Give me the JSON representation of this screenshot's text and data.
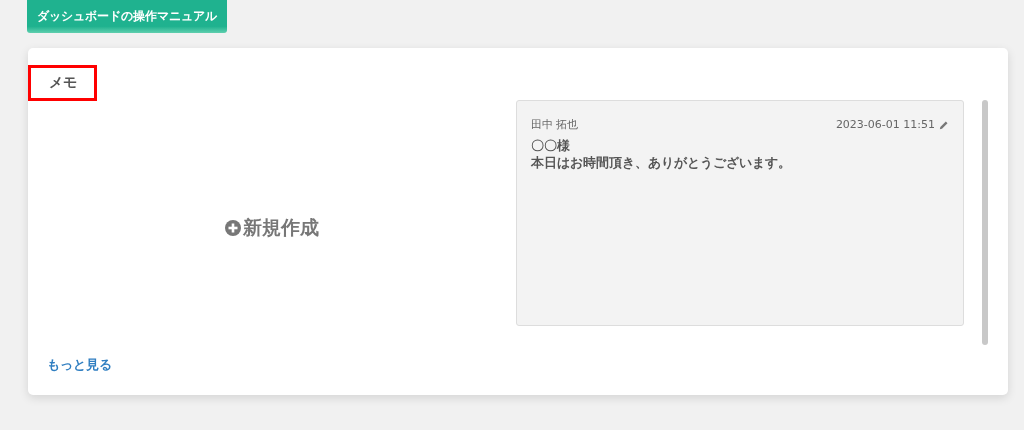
{
  "manual_button": {
    "label": "ダッシュボードの操作マニュアル"
  },
  "memo_panel": {
    "title": {
      "text": "メモ",
      "highlighted": true
    },
    "new_button": {
      "label": "新規作成"
    },
    "memos": [
      {
        "author": "田中 拓也",
        "timestamp": "2023-06-01 11:51",
        "body": [
          "〇〇様",
          "本日はお時間頂き、ありがとうございます。"
        ]
      }
    ],
    "more_link": "もっと見る"
  }
}
